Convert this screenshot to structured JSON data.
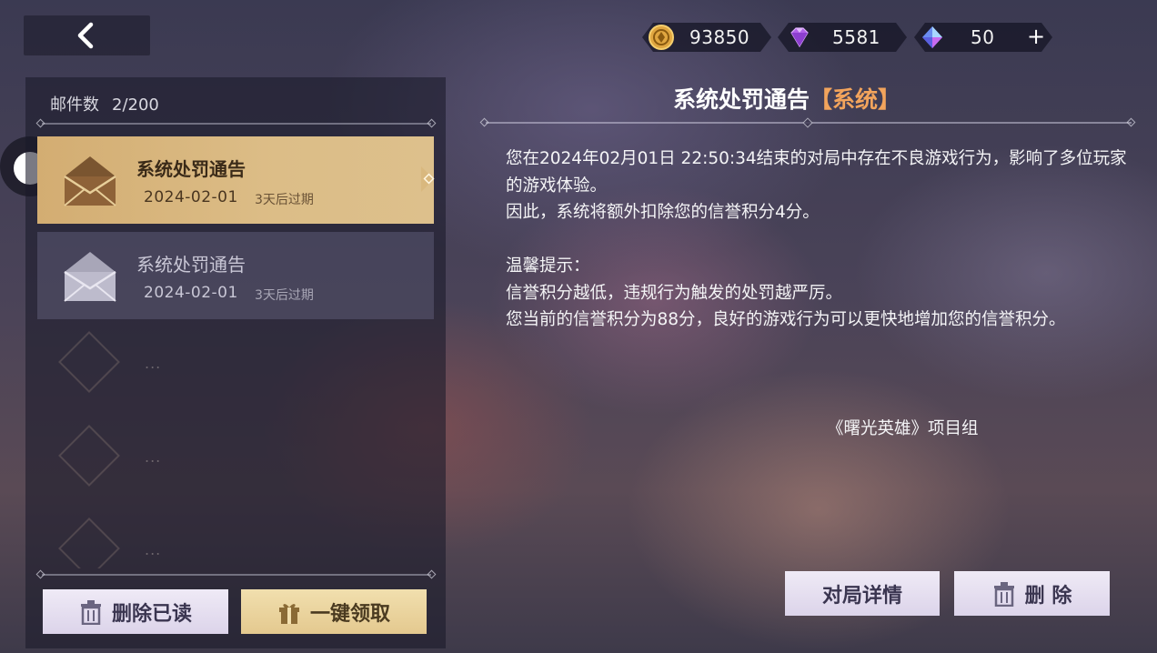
{
  "header": {
    "back_icon": "chevron-left-icon",
    "currencies": [
      {
        "icon": "gold-coin-icon",
        "value": "93850"
      },
      {
        "icon": "purple-gem-icon",
        "value": "5581"
      },
      {
        "icon": "blue-diamond-icon",
        "value": "50"
      }
    ],
    "plus_label": "+"
  },
  "mail_list": {
    "count_label": "邮件数",
    "count_value": "2/200",
    "items": [
      {
        "title": "系统处罚通告",
        "date": "2024-02-01",
        "expire": "3天后过期",
        "selected": true
      },
      {
        "title": "系统处罚通告",
        "date": "2024-02-01",
        "expire": "3天后过期",
        "selected": false
      }
    ],
    "placeholder_text": "...",
    "delete_read_label": "删除已读",
    "claim_all_label": "一键领取"
  },
  "detail": {
    "title": "系统处罚通告",
    "tag": "【系统】",
    "paragraphs": [
      "您在2024年02月01日 22:50:34结束的对局中存在不良游戏行为，影响了多位玩家的游戏体验。",
      "因此，系统将额外扣除您的信誉积分4分。",
      "温馨提示：",
      "信誉积分越低，违规行为触发的处罚越严厉。",
      "您当前的信誉积分为88分，良好的游戏行为可以更快地增加您的信誉积分。"
    ],
    "signature": "《曙光英雄》项目组",
    "match_details_label": "对局详情",
    "delete_label": "删 除"
  },
  "colors": {
    "accent_gold": "#d3ad72",
    "tag_orange": "#f2a45c",
    "button_purple": "#e6dff0"
  }
}
